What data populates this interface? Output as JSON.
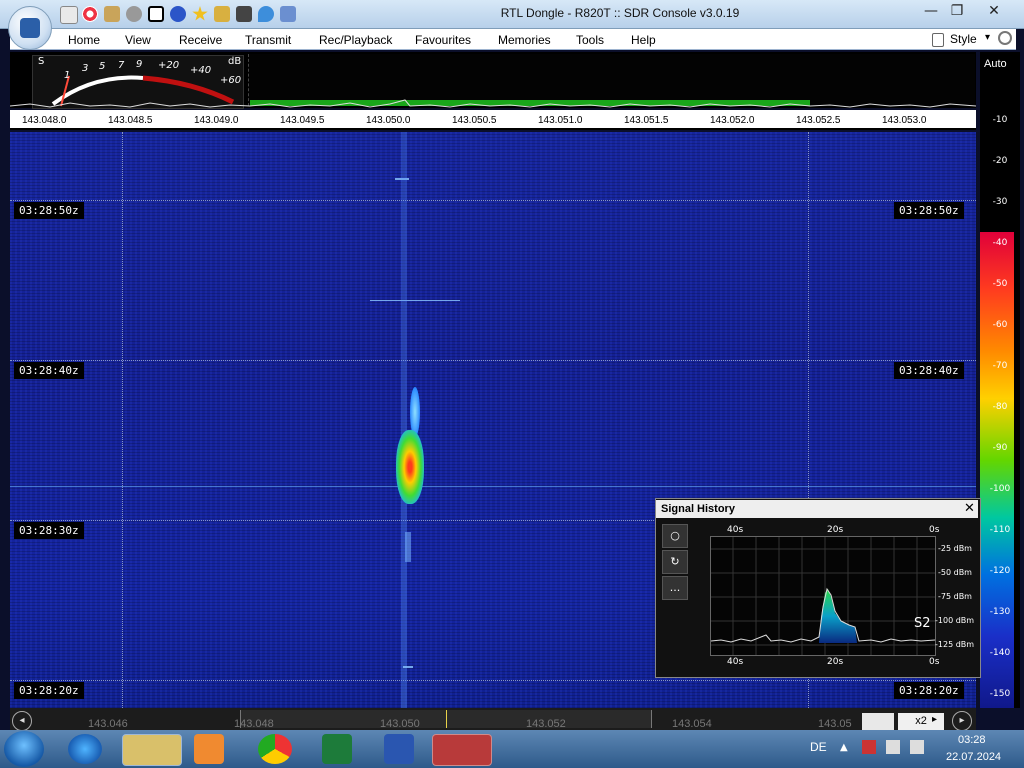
{
  "window": {
    "title": "RTL Dongle - R820T :: SDR Console v3.0.19",
    "minimize": "—",
    "maximize": "❐",
    "close": "✕"
  },
  "menu": {
    "items": [
      "Home",
      "View",
      "Receive",
      "Transmit",
      "Rec/Playback",
      "Favourites",
      "Memories",
      "Tools",
      "Help"
    ],
    "style_label": "Style"
  },
  "smeter": {
    "s_label": "S",
    "db_label": "dB",
    "scale": [
      "1",
      "3",
      "5",
      "7",
      "9",
      "+20",
      "+40",
      "+60"
    ]
  },
  "frequency_ruler": [
    "143.048.0",
    "143.048.5",
    "143.049.0",
    "143.049.5",
    "143.050.0",
    "143.050.5",
    "143.051.0",
    "143.051.5",
    "143.052.0",
    "143.052.5",
    "143.053.0"
  ],
  "waterfall": {
    "time_labels": [
      "03:28:50z",
      "03:28:40z",
      "03:28:30z",
      "03:28:20z"
    ]
  },
  "db_scale": {
    "auto_label": "Auto",
    "ticks": [
      "-10",
      "-20",
      "-30",
      "-40",
      "-50",
      "-60",
      "-70",
      "-80",
      "-90",
      "-100",
      "-110",
      "-120",
      "-130",
      "-140",
      "-150"
    ]
  },
  "signal_history": {
    "title": "Signal History",
    "close": "✕",
    "x_ticks_top": [
      "40s",
      "20s",
      "0s"
    ],
    "x_ticks_bottom": [
      "40s",
      "20s",
      "0s"
    ],
    "y_ticks": [
      "-25 dBm",
      "-50 dBm",
      "-75 dBm",
      "-100 dBm",
      "-125 dBm"
    ],
    "s_reading": "S2",
    "buttons": [
      "○",
      "↻",
      "..."
    ]
  },
  "scrollbar": {
    "ticks": [
      "143.046",
      "143.048",
      "143.050",
      "143.052",
      "143.054",
      "143.05"
    ],
    "zoom": "x2"
  },
  "taskbar": {
    "language": "DE",
    "time": "03:28",
    "date": "22.07.2024"
  },
  "colors": {
    "waterfall_bg": "#1424a0",
    "signal_core": "#ffcc00",
    "meter_red": "#c01010",
    "green_bar": "#1aa61a"
  }
}
